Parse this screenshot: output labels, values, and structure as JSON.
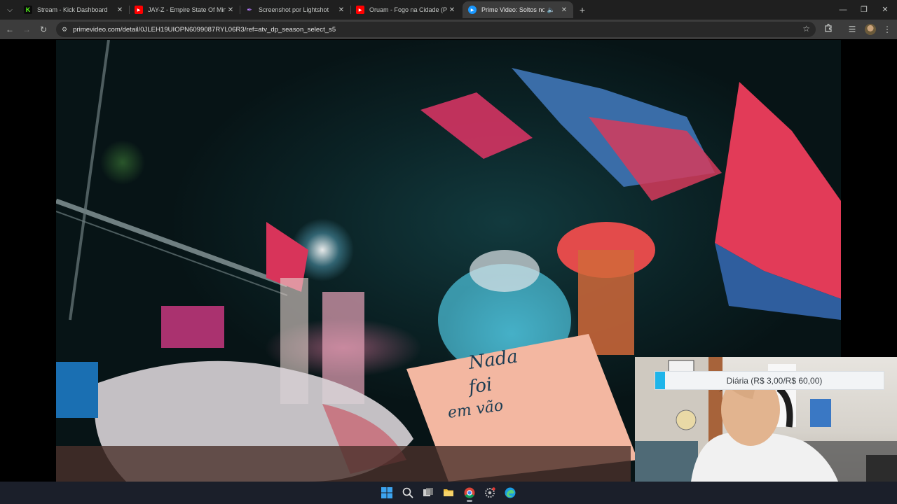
{
  "browser": {
    "tabs": [
      {
        "title": "Stream - Kick Dashboard",
        "favicon": "kick-logo-icon",
        "active": false
      },
      {
        "title": "JAY-Z - Empire State Of Mind ft",
        "favicon": "youtube-icon",
        "active": false
      },
      {
        "title": "Screenshot por Lightshot",
        "favicon": "lightshot-feather-icon",
        "active": false
      },
      {
        "title": "Oruam - Fogo na Cidade (Prod",
        "favicon": "youtube-icon",
        "active": false
      },
      {
        "title": "Prime Video: Soltos no Car",
        "favicon": "prime-video-icon",
        "active": true,
        "audio": "speaker-icon"
      }
    ],
    "address": "primevideo.com/detail/0JLEH19UIOPN6099087RYL06R3/ref=atv_dp_season_select_s5",
    "icons": {
      "tab_search": "chevron-down-icon",
      "new_tab": "plus-icon",
      "back": "arrow-left-icon",
      "forward": "arrow-right-icon",
      "reload": "reload-icon",
      "site_info": "tune-icon",
      "bookmark": "star-icon",
      "extensions": "puzzle-icon",
      "media": "media-control-icon",
      "profile": "avatar",
      "menu": "kebab-menu-icon",
      "minimize": "minimize-icon",
      "restore": "restore-icon",
      "close": "close-icon"
    }
  },
  "overlay": {
    "text": "Diária (R$ 3,00/R$ 60,00)",
    "accent_color": "#1fb5ea"
  },
  "taskbar": {
    "items": [
      "windows-start-icon",
      "search-icon",
      "task-view-icon",
      "file-explorer-icon",
      "chrome-icon",
      "settings-icon",
      "edge-icon"
    ]
  },
  "colors": {
    "tabstrip": "#1f1f1f",
    "toolbar": "#3c3c3c",
    "omnibox": "#282828",
    "taskbar": "#1b1f2a"
  }
}
